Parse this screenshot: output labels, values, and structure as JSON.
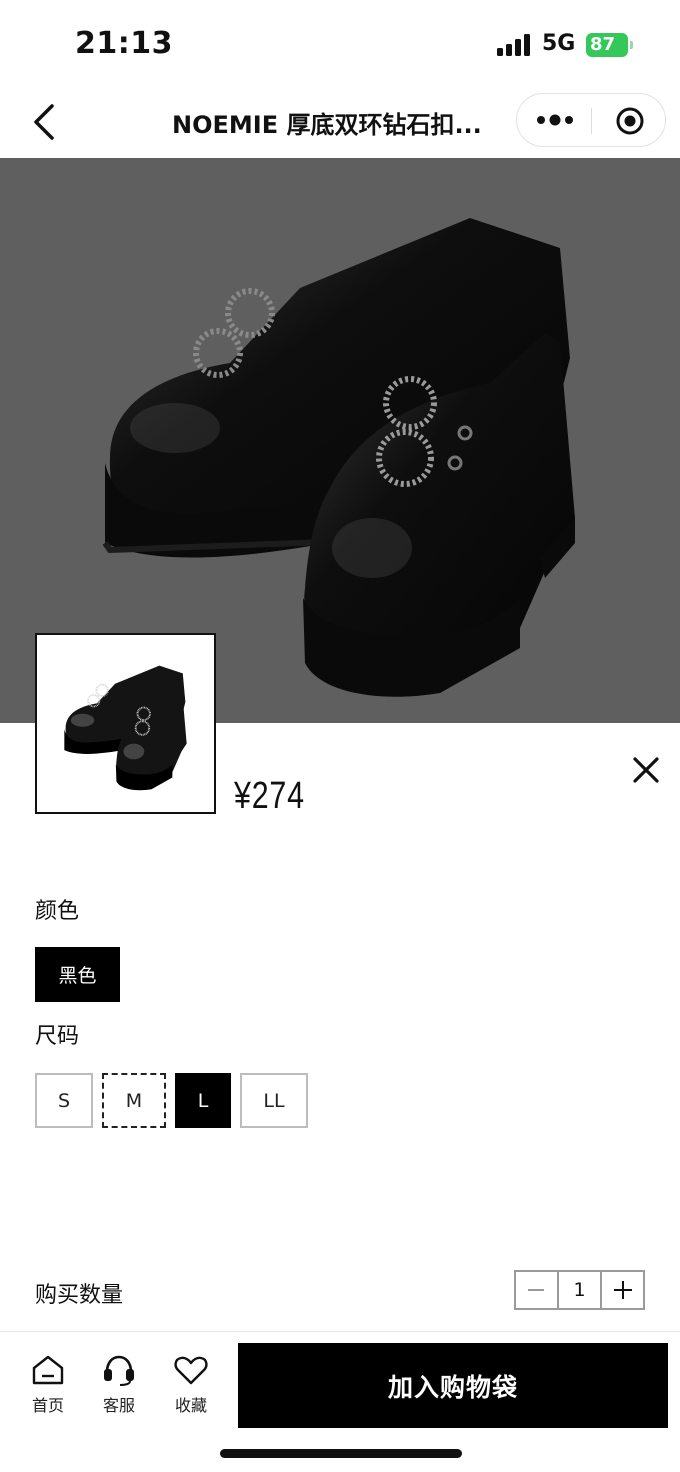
{
  "status_bar": {
    "time": "21:13",
    "network": "5G",
    "battery": "87"
  },
  "nav": {
    "title": "NOEMIE 厚底双环钻石扣..."
  },
  "product": {
    "price": "¥274"
  },
  "color": {
    "label": "颜色",
    "options": [
      {
        "label": "黑色",
        "selected": true
      }
    ]
  },
  "size": {
    "label": "尺码",
    "options": [
      {
        "label": "S",
        "state": "available"
      },
      {
        "label": "M",
        "state": "unavailable"
      },
      {
        "label": "L",
        "state": "selected"
      },
      {
        "label": "LL",
        "state": "available"
      }
    ]
  },
  "quantity": {
    "label": "购买数量",
    "value": "1"
  },
  "tabbar": {
    "items": [
      {
        "label": "首页",
        "icon": "home-icon"
      },
      {
        "label": "客服",
        "icon": "headset-icon"
      },
      {
        "label": "收藏",
        "icon": "heart-icon"
      }
    ],
    "add_to_cart": "加入购物袋"
  },
  "colors": {
    "overlay": "#5f5f5f",
    "primary": "#000000",
    "battery": "#34c759"
  }
}
